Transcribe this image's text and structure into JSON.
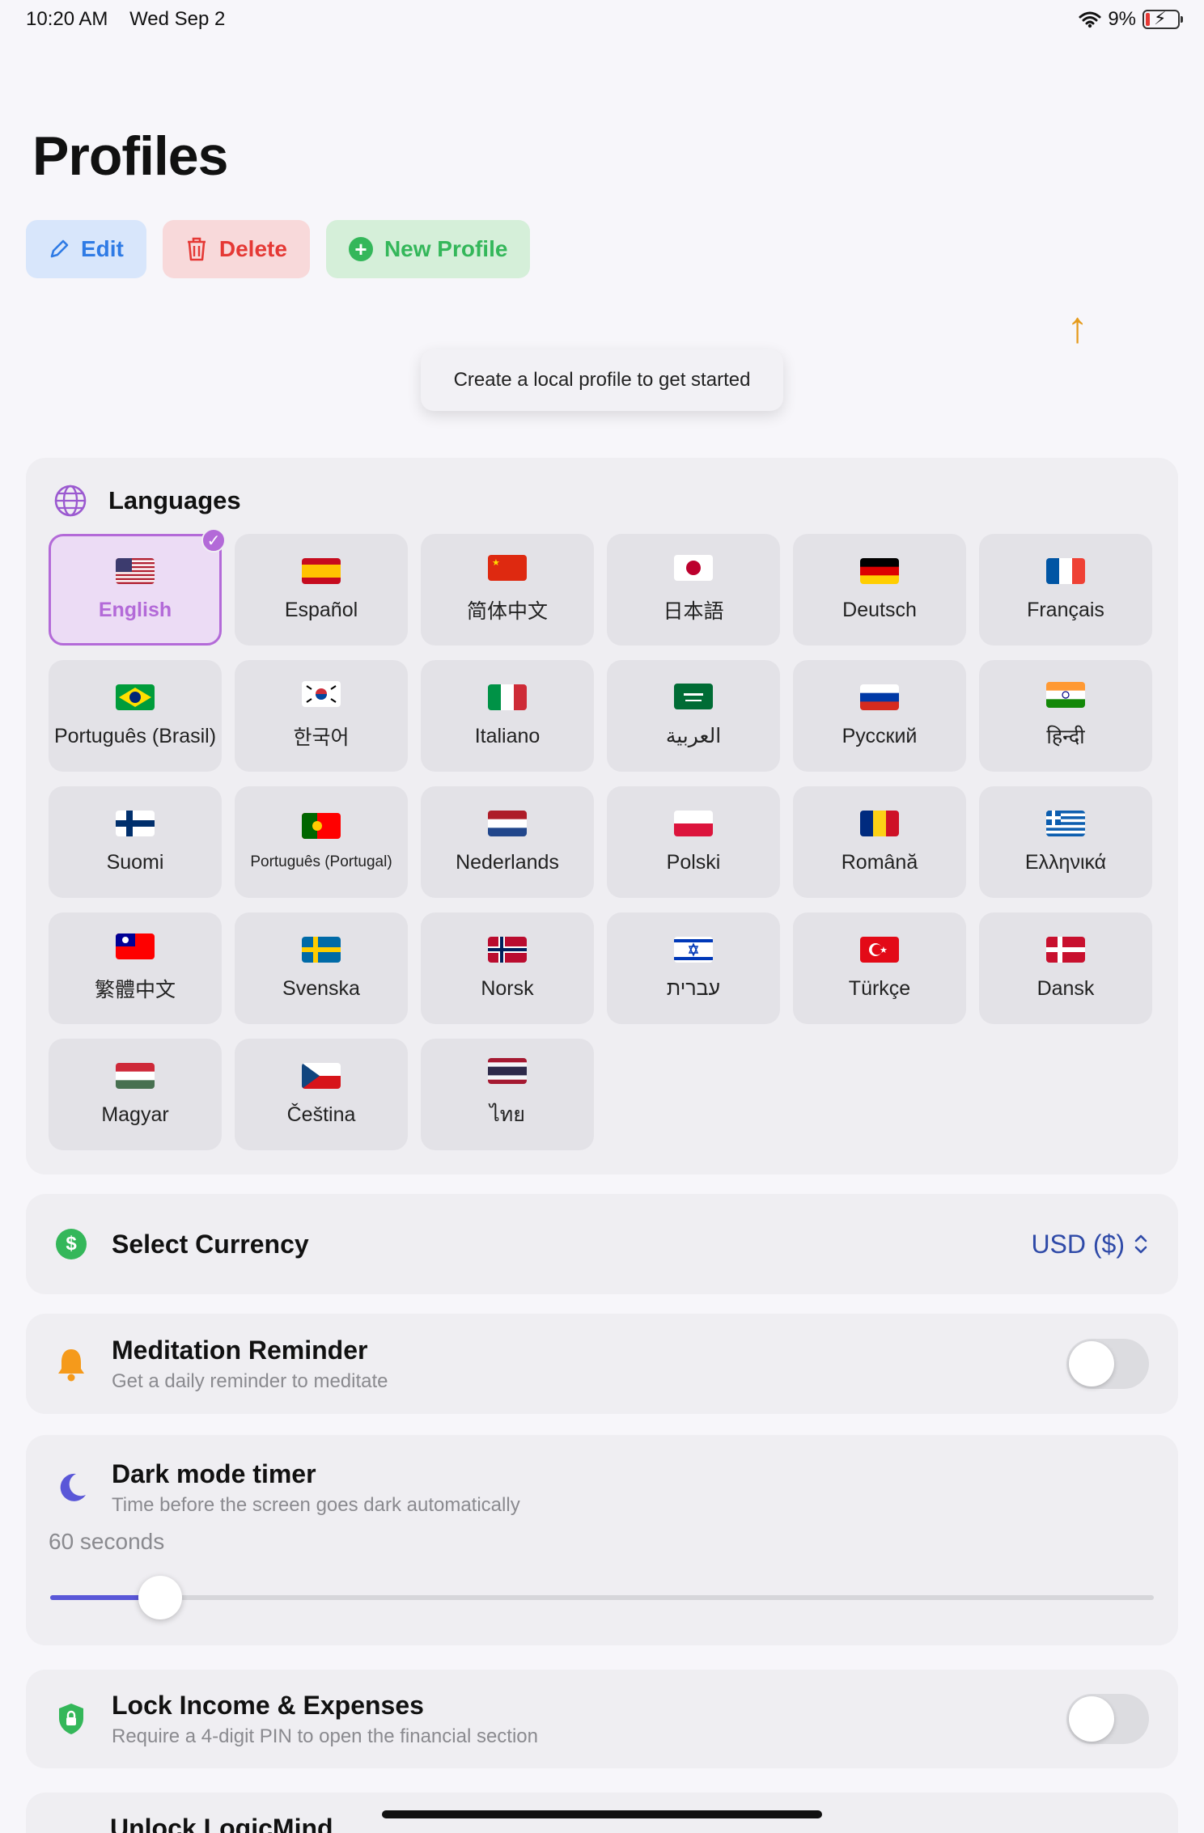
{
  "status_bar": {
    "time": "10:20 AM",
    "date": "Wed Sep 2",
    "battery": "9%"
  },
  "page": {
    "title": "Profiles"
  },
  "actions": {
    "edit": "Edit",
    "delete": "Delete",
    "new_profile": "New Profile"
  },
  "tooltip": {
    "text": "Create a local profile to get started"
  },
  "languages": {
    "title": "Languages",
    "selected": "English",
    "items": [
      {
        "label": "English",
        "flag": "us"
      },
      {
        "label": "Español",
        "flag": "es"
      },
      {
        "label": "简体中文",
        "flag": "cn"
      },
      {
        "label": "日本語",
        "flag": "jp"
      },
      {
        "label": "Deutsch",
        "flag": "de"
      },
      {
        "label": "Français",
        "flag": "fr"
      },
      {
        "label": "Português (Brasil)",
        "flag": "br"
      },
      {
        "label": "한국어",
        "flag": "kr"
      },
      {
        "label": "Italiano",
        "flag": "it"
      },
      {
        "label": "العربية",
        "flag": "sa"
      },
      {
        "label": "Русский",
        "flag": "ru"
      },
      {
        "label": "हिन्दी",
        "flag": "in"
      },
      {
        "label": "Suomi",
        "flag": "fi"
      },
      {
        "label": "Português (Portugal)",
        "flag": "pt"
      },
      {
        "label": "Nederlands",
        "flag": "nl"
      },
      {
        "label": "Polski",
        "flag": "pl"
      },
      {
        "label": "Română",
        "flag": "ro"
      },
      {
        "label": "Ελληνικά",
        "flag": "gr"
      },
      {
        "label": "繁體中文",
        "flag": "tw"
      },
      {
        "label": "Svenska",
        "flag": "se"
      },
      {
        "label": "Norsk",
        "flag": "no"
      },
      {
        "label": "עברית",
        "flag": "il"
      },
      {
        "label": "Türkçe",
        "flag": "tr"
      },
      {
        "label": "Dansk",
        "flag": "dk"
      },
      {
        "label": "Magyar",
        "flag": "hu"
      },
      {
        "label": "Čeština",
        "flag": "cz"
      },
      {
        "label": "ไทย",
        "flag": "th"
      }
    ]
  },
  "currency": {
    "title": "Select Currency",
    "value": "USD ($)"
  },
  "meditation": {
    "title": "Meditation Reminder",
    "subtitle": "Get a daily reminder to meditate",
    "enabled": false
  },
  "dark_mode": {
    "title": "Dark mode timer",
    "subtitle": "Time before the screen goes dark automatically",
    "value_label": "60 seconds",
    "slider_fraction": 0.1
  },
  "lock": {
    "title": "Lock Income & Expenses",
    "subtitle": "Require a 4-digit PIN to open the financial section",
    "enabled": false
  },
  "unlock": {
    "title": "Unlock LogicMind"
  },
  "colors": {
    "accent": "#b36ad8",
    "edit": "#2f7be5",
    "delete": "#e53935",
    "new": "#34b75a",
    "currency": "#2f4aa8",
    "slider": "#5a57d8"
  }
}
